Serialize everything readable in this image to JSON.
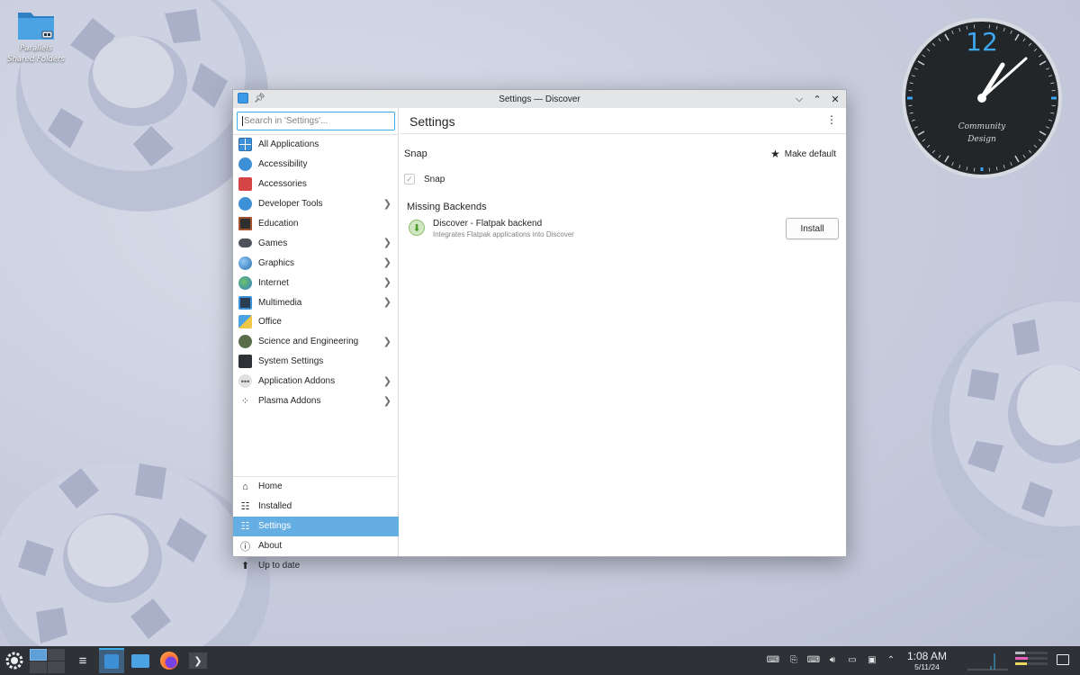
{
  "desktop": {
    "icon_label": "Parallels Shared Folders"
  },
  "clock": {
    "hour_numeral": "12",
    "brand_line1": "Community",
    "brand_line2": "Design",
    "time_shown": "1:08"
  },
  "window": {
    "title": "Settings — Discover",
    "search_placeholder": "Search in 'Settings'...",
    "page_title": "Settings",
    "categories": [
      {
        "label": "All Applications",
        "icon": "grid-icon",
        "has_children": false
      },
      {
        "label": "Accessibility",
        "icon": "accessibility-icon",
        "has_children": false
      },
      {
        "label": "Accessories",
        "icon": "toolbox-icon",
        "has_children": false
      },
      {
        "label": "Developer Tools",
        "icon": "wrench-icon",
        "has_children": true
      },
      {
        "label": "Education",
        "icon": "chalkboard-icon",
        "has_children": false
      },
      {
        "label": "Games",
        "icon": "gamepad-icon",
        "has_children": true
      },
      {
        "label": "Graphics",
        "icon": "sphere-icon",
        "has_children": true
      },
      {
        "label": "Internet",
        "icon": "globe-icon",
        "has_children": true
      },
      {
        "label": "Multimedia",
        "icon": "monitor-play-icon",
        "has_children": true
      },
      {
        "label": "Office",
        "icon": "office-icon",
        "has_children": false
      },
      {
        "label": "Science and Engineering",
        "icon": "flask-icon",
        "has_children": true
      },
      {
        "label": "System Settings",
        "icon": "terminal-icon",
        "has_children": false
      },
      {
        "label": "Application Addons",
        "icon": "dots-icon",
        "has_children": true
      },
      {
        "label": "Plasma Addons",
        "icon": "plasma-icon",
        "has_children": true
      }
    ],
    "nav": [
      {
        "label": "Home",
        "icon": "home-icon",
        "active": false
      },
      {
        "label": "Installed",
        "icon": "installed-icon",
        "active": false
      },
      {
        "label": "Settings",
        "icon": "settings-sliders-icon",
        "active": true
      },
      {
        "label": "About",
        "icon": "info-icon",
        "active": false
      },
      {
        "label": "Up to date",
        "icon": "update-icon",
        "active": false
      }
    ],
    "snap_section_title": "Snap",
    "make_default_label": "Make default",
    "snap_source_label": "Snap",
    "missing_section_title": "Missing Backends",
    "backend_name": "Discover - Flatpak backend",
    "backend_desc": "Integrates Flatpak applications into Discover",
    "install_label": "Install"
  },
  "taskbar": {
    "time": "1:08 AM",
    "date": "5/11/24"
  },
  "colors": {
    "accent": "#3daee9",
    "active_nav": "#64aee3",
    "taskbar": "#2e3136",
    "clock_accent": "#3da7ef"
  }
}
